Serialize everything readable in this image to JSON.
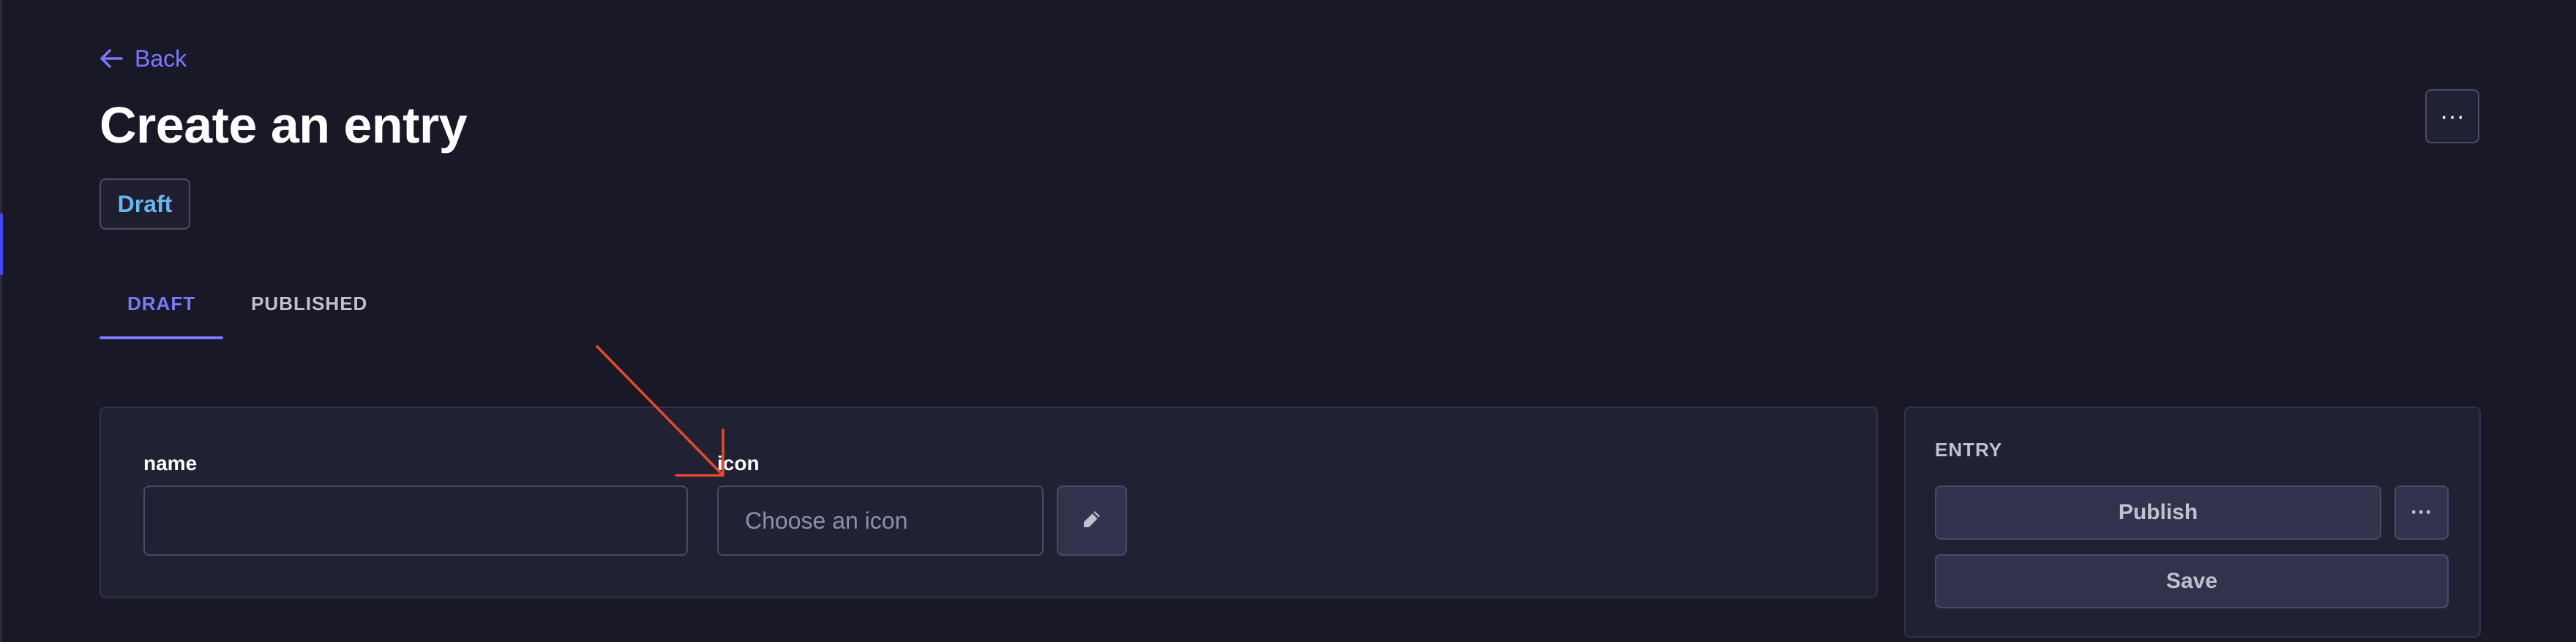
{
  "header": {
    "back_label": "Back",
    "title": "Create an entry",
    "status_badge": "Draft",
    "more_label": "···"
  },
  "tabs": [
    {
      "label": "DRAFT",
      "active": true
    },
    {
      "label": "PUBLISHED",
      "active": false
    }
  ],
  "form": {
    "name": {
      "label": "name",
      "value": ""
    },
    "icon": {
      "label": "icon",
      "placeholder": "Choose an icon"
    }
  },
  "sidebar": {
    "title": "ENTRY",
    "publish_label": "Publish",
    "more_label": "···",
    "save_label": "Save"
  },
  "icons": {
    "back": "arrow-left-icon",
    "edit": "pencil-icon",
    "more": "ellipsis-icon"
  },
  "colors": {
    "background": "#181826",
    "surface": "#212134",
    "border": "#4a4a6a",
    "accent": "#7b79ff",
    "badge_text": "#66b7f1",
    "annotation_arrow": "#e8482f"
  }
}
